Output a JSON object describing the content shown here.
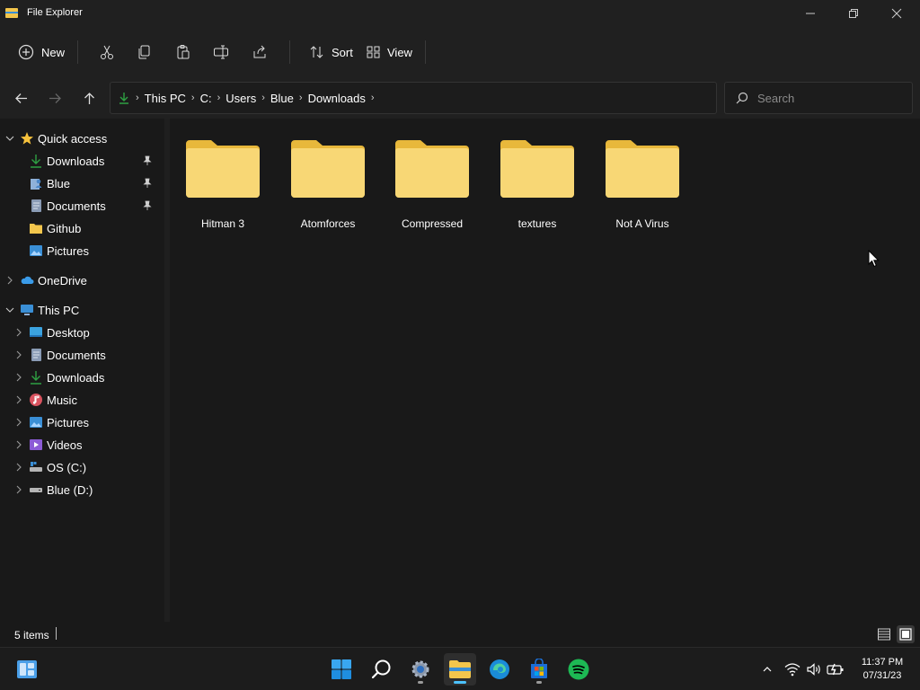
{
  "window": {
    "title": "File Explorer",
    "controls": [
      "minimize",
      "restore",
      "close"
    ]
  },
  "toolbar": {
    "new_label": "New",
    "sort_label": "Sort",
    "view_label": "View",
    "icons": [
      "cut-icon",
      "copy-icon",
      "paste-icon",
      "rename-icon",
      "share-icon"
    ]
  },
  "breadcrumb": [
    "This PC",
    "C:",
    "Users",
    "Blue",
    "Downloads"
  ],
  "search": {
    "placeholder": "Search"
  },
  "sidebar": {
    "quick_access": {
      "label": "Quick access",
      "items": [
        {
          "label": "Downloads",
          "icon": "download-icon",
          "pinned": true
        },
        {
          "label": "Blue",
          "icon": "user-folder-icon",
          "pinned": true
        },
        {
          "label": "Documents",
          "icon": "documents-icon",
          "pinned": true
        },
        {
          "label": "Github",
          "icon": "folder-icon",
          "pinned": false
        },
        {
          "label": "Pictures",
          "icon": "pictures-icon",
          "pinned": false
        }
      ]
    },
    "onedrive": {
      "label": "OneDrive"
    },
    "this_pc": {
      "label": "This PC",
      "items": [
        {
          "label": "Desktop",
          "icon": "desktop-icon"
        },
        {
          "label": "Documents",
          "icon": "documents-icon"
        },
        {
          "label": "Downloads",
          "icon": "download-icon"
        },
        {
          "label": "Music",
          "icon": "music-icon"
        },
        {
          "label": "Pictures",
          "icon": "pictures-icon"
        },
        {
          "label": "Videos",
          "icon": "videos-icon"
        },
        {
          "label": "OS (C:)",
          "icon": "drive-icon"
        },
        {
          "label": "Blue (D:)",
          "icon": "drive-icon"
        }
      ]
    }
  },
  "folders": [
    {
      "name": "Hitman 3"
    },
    {
      "name": "Atomforces"
    },
    {
      "name": "Compressed"
    },
    {
      "name": "textures"
    },
    {
      "name": "Not A Virus"
    }
  ],
  "status": {
    "items_text": "5 items"
  },
  "taskbar": {
    "apps": [
      "widgets",
      "start",
      "search",
      "settings",
      "file-explorer",
      "edge",
      "store",
      "spotify"
    ],
    "clock": {
      "time": "11:37 PM",
      "date": "07/31/23"
    }
  },
  "colors": {
    "folder": "#f8d775",
    "folder_dark": "#e8b83b",
    "accent": "#4cc2ff",
    "download_green": "#2ea043",
    "spotify": "#1db954"
  }
}
